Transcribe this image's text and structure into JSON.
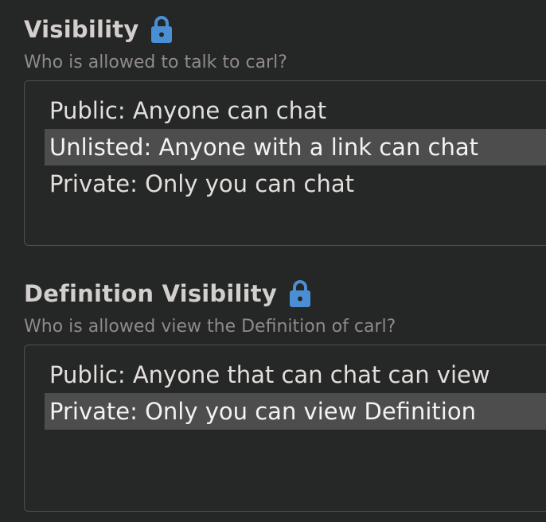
{
  "accent_color": "#4a8fd4",
  "visibility": {
    "title": "Visibility",
    "lock_icon": "lock-icon",
    "description": "Who is allowed to talk to carl?",
    "options": [
      {
        "label": "Public: Anyone can chat",
        "selected": false
      },
      {
        "label": "Unlisted: Anyone with a link can chat",
        "selected": true
      },
      {
        "label": "Private: Only you can chat",
        "selected": false
      }
    ]
  },
  "definition_visibility": {
    "title": "Definition Visibility",
    "lock_icon": "lock-icon",
    "description": "Who is allowed view the Definition of carl?",
    "options": [
      {
        "label": "Public: Anyone that can chat can view",
        "selected": false
      },
      {
        "label": "Private: Only you can view Definition",
        "selected": true
      }
    ]
  }
}
